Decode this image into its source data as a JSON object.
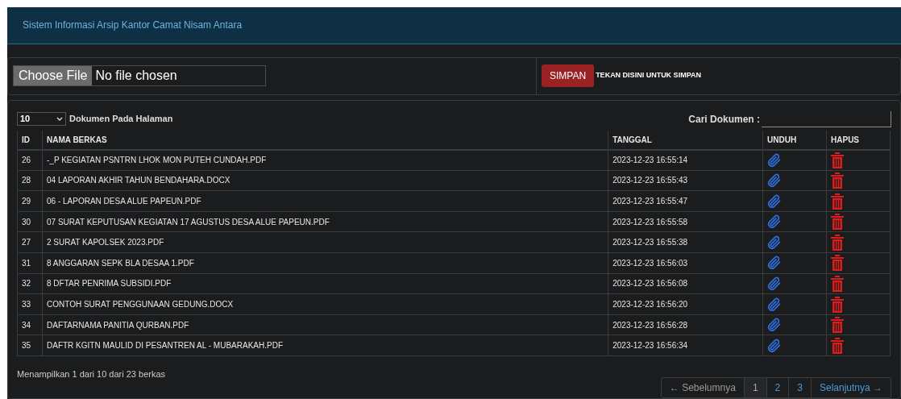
{
  "header": {
    "title": "Sistem Informasi Arsip Kantor Camat Nisam Antara"
  },
  "upload": {
    "file_button": "Choose File",
    "file_status": "No file chosen",
    "save_button": "SIMPAN",
    "save_hint": "TEKAN DISINI UNTUK SIMPAN"
  },
  "table_controls": {
    "page_size": "10",
    "page_size_label": "Dokumen Pada Halaman",
    "search_label": "Cari Dokumen :"
  },
  "table": {
    "columns": [
      "ID",
      "NAMA BERKAS",
      "TANGGAL",
      "UNDUH",
      "HAPUS"
    ],
    "rows": [
      {
        "id": "26",
        "name": "-_P KEGIATAN PSNTRN LHOK MON PUTEH CUNDAH.PDF",
        "date": "2023-12-23 16:55:14"
      },
      {
        "id": "28",
        "name": "04 LAPORAN AKHIR TAHUN BENDAHARA.DOCX",
        "date": "2023-12-23 16:55:43"
      },
      {
        "id": "29",
        "name": "06 - LAPORAN DESA ALUE PAPEUN.PDF",
        "date": "2023-12-23 16:55:47"
      },
      {
        "id": "30",
        "name": "07 SURAT KEPUTUSAN KEGIATAN 17 AGUSTUS DESA ALUE PAPEUN.PDF",
        "date": "2023-12-23 16:55:58"
      },
      {
        "id": "27",
        "name": "2 SURAT KAPOLSEK 2023.PDF",
        "date": "2023-12-23 16:55:38"
      },
      {
        "id": "31",
        "name": "8 ANGGARAN SEPK BLA DESAA 1.PDF",
        "date": "2023-12-23 16:56:03"
      },
      {
        "id": "32",
        "name": "8 DFTAR PENRIMA SUBSIDI.PDF",
        "date": "2023-12-23 16:56:08"
      },
      {
        "id": "33",
        "name": "CONTOH SURAT PENGGUNAAN GEDUNG.DOCX",
        "date": "2023-12-23 16:56:20"
      },
      {
        "id": "34",
        "name": "DAFTARNAMA PANITIA QURBAN.PDF",
        "date": "2023-12-23 16:56:28"
      },
      {
        "id": "35",
        "name": "DAFTR KGITN MAULID DI PESANTREN AL - MUBARAKAH.PDF",
        "date": "2023-12-23 16:56:34"
      }
    ]
  },
  "footer": {
    "summary": "Menampilkan 1 dari 10 dari 23 berkas",
    "pagination": [
      {
        "label": "← Sebelumnya",
        "selected": false,
        "disabled": true
      },
      {
        "label": "1",
        "selected": true,
        "disabled": false
      },
      {
        "label": "2",
        "selected": false,
        "disabled": false
      },
      {
        "label": "3",
        "selected": false,
        "disabled": false
      },
      {
        "label": "Selanjutnya →",
        "selected": false,
        "disabled": false
      }
    ]
  }
}
